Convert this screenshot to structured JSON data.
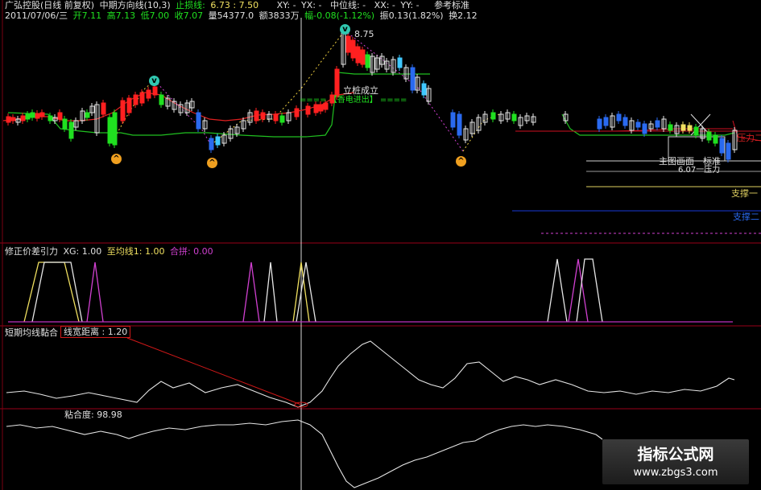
{
  "header": {
    "stock": "广弘控股(日线 前复权)",
    "indicator": "中期方向线(10,3)",
    "stop_label": "止损线:",
    "stop_values": "6.73 : 7.50",
    "xy": "XY: -",
    "yx": "YX: -",
    "mid_label": "中位线: -",
    "xx": "XX: -",
    "yy": "YY: -",
    "ref_label": "参考标准",
    "date": "2011/07/06/三",
    "open": "开7.11",
    "high": "高7.13",
    "low": "低7.00",
    "close": "收7.07",
    "volume": "量54377.0",
    "amount": "额3833万",
    "change": "幅-0.08(-1.12%)",
    "amplitude": "振0.13(1.82%)",
    "turnover": "换2.12"
  },
  "main_panel": {
    "high_mark": "8.75",
    "signal_1": "立桩成立",
    "signal_2": "==== 【香电进出】 ====",
    "right_label_1": "压力二",
    "right_label_2": "主图画面一标准",
    "right_label_3": "6.07一压力",
    "right_label_4": "支撑一",
    "right_label_5": "支撑二"
  },
  "panel2": {
    "title": "修正价差引力",
    "xg": "XG: 1.00",
    "ma1": "至均线1: 1.00",
    "combo": "合拼: 0.00"
  },
  "panel3": {
    "title": "短期均线黏合",
    "box_label": "线宽距离 : 1.20"
  },
  "panel4": {
    "label": "粘合度: 98.98"
  },
  "watermark": {
    "title": "指标公式网",
    "url": "www.zbgs3.com"
  },
  "colors": {
    "up": "#ff2020",
    "down": "#40c8ff",
    "green": "#20e020",
    "blue": "#2a6af0",
    "yellow": "#f0e060",
    "magenta": "#e040e0",
    "white": "#e6e6e6",
    "separator": "#b00020"
  }
}
